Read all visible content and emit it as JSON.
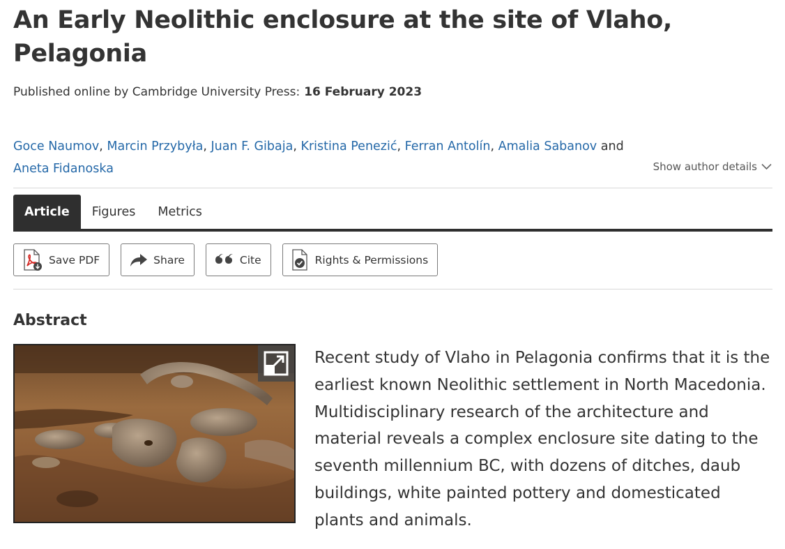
{
  "article": {
    "title": "An Early Neolithic enclosure at the site of Vlaho, Pelagonia",
    "published_label": "Published online by Cambridge University Press:",
    "published_date": "16 February 2023"
  },
  "authors": {
    "list": [
      "Goce Naumov",
      "Marcin Przybyła",
      "Juan F. Gibaja",
      "Kristina Penezić",
      "Ferran Antolín",
      "Amalia Sabanov",
      "Aneta Fidanoska"
    ],
    "separator": ",",
    "conjunction": "and",
    "details_toggle": "Show author details"
  },
  "tabs": [
    {
      "label": "Article",
      "active": true
    },
    {
      "label": "Figures",
      "active": false
    },
    {
      "label": "Metrics",
      "active": false
    }
  ],
  "actions": {
    "save_pdf": "Save PDF",
    "share": "Share",
    "cite": "Cite",
    "rights": "Rights & Permissions"
  },
  "abstract": {
    "heading": "Abstract",
    "text": "Recent study of Vlaho in Pelagonia confirms that it is the earliest known Neolithic settlement in North Macedonia. Multidisciplinary research of the architecture and material reveals a complex enclosure site dating to the seventh millennium BC, with dozens of ditches, daub buildings, white painted pottery and domesticated plants and animals."
  },
  "icons": {
    "pdf": "pdf-file-icon",
    "share": "share-arrow-icon",
    "cite": "quote-icon",
    "rights": "document-check-icon",
    "expand": "expand-icon",
    "chevron": "chevron-down-icon"
  },
  "colors": {
    "link": "#2468a8",
    "tab_active_bg": "#2f2f2f",
    "text": "#333333",
    "pdf_red": "#d4221e"
  }
}
